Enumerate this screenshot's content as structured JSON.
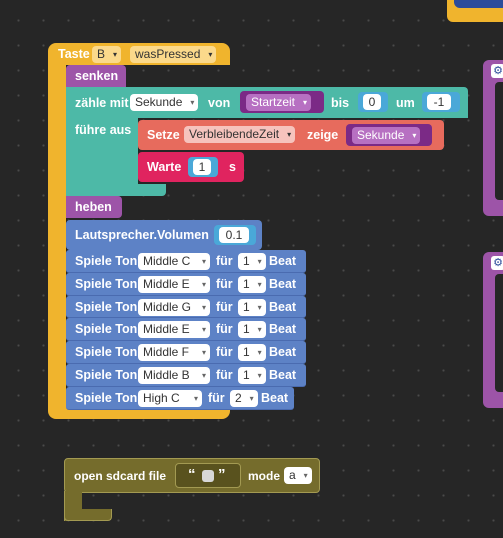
{
  "colors": {
    "event": "#f0b42d",
    "motion": "#9d54a8",
    "loop": "#4db9a7",
    "text": "#e76b5d",
    "control": "#e0245f",
    "music": "#5d82c6",
    "file": "#756c2c",
    "numslot": "#4aa8d8"
  },
  "event_block": {
    "prefix": "Taste",
    "button": "B",
    "event": "wasPressed"
  },
  "pen_down": {
    "label": "senken"
  },
  "loop": {
    "label": "zähle mit",
    "variable": "Sekunde",
    "from_label": "von",
    "from_value": "Startzeit",
    "to_label": "bis",
    "to_value": "0",
    "step_label": "um",
    "step_value": "-1",
    "do_label": "führe aus"
  },
  "set_text": {
    "label": "Setze",
    "target": "VerbleibendeZeit",
    "show_label": "zeige",
    "value": "Sekunde"
  },
  "wait": {
    "label": "Warte",
    "value": "1",
    "unit": "s"
  },
  "pen_up": {
    "label": "heben"
  },
  "volume": {
    "label": "Lautsprecher.Volumen",
    "value": "0.1"
  },
  "tones": [
    {
      "label": "Spiele Ton",
      "note": "Middle C",
      "for_label": "für",
      "beats": "1",
      "unit": "Beat"
    },
    {
      "label": "Spiele Ton",
      "note": "Middle E",
      "for_label": "für",
      "beats": "1",
      "unit": "Beat"
    },
    {
      "label": "Spiele Ton",
      "note": "Middle G",
      "for_label": "für",
      "beats": "1",
      "unit": "Beat"
    },
    {
      "label": "Spiele Ton",
      "note": "Middle E",
      "for_label": "für",
      "beats": "1",
      "unit": "Beat"
    },
    {
      "label": "Spiele Ton",
      "note": "Middle F",
      "for_label": "für",
      "beats": "1",
      "unit": "Beat"
    },
    {
      "label": "Spiele Ton",
      "note": "Middle B",
      "for_label": "für",
      "beats": "1",
      "unit": "Beat"
    },
    {
      "label": "Spiele Ton",
      "note": "High C",
      "for_label": "für",
      "beats": "2",
      "unit": "Beat"
    }
  ],
  "sdcard": {
    "label": "open sdcard file",
    "quote_open": "“",
    "quote_close": "”",
    "mode_label": "mode",
    "mode_value": "a"
  },
  "icons": {
    "gear": "⚙",
    "dropdown": "▾"
  }
}
